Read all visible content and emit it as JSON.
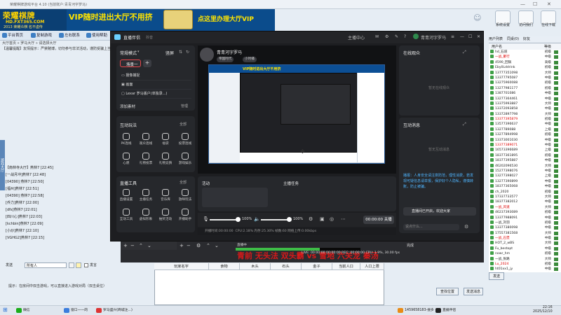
{
  "client": {
    "window_title": "荣耀棋牌游戏平台 4.10 (当前账户:青青河字罗马)",
    "logo_line1": "荣耀棋牌",
    "logo_domain": "HD.FXT365.COM",
    "logo_slogan": "2013 荣耀众棋 名不虚传",
    "banner_left": "VIP随时进出大厅不用挤",
    "banner_right": "点这里办理大厅VIP",
    "tools": [
      {
        "label": "系统设置"
      },
      {
        "label": "访问我们"
      },
      {
        "label": "在线下载"
      }
    ],
    "nav": [
      "平台首页",
      "复制游戏",
      "左右联系",
      "使用帮助"
    ],
    "breadcrumb": "大厅首页 » 罗马大厅 » 请选择大厅",
    "notice": "【温馨提醒】友情提示：严禁赌博，切勿参与非法活动，谨防受骗上当。",
    "left_strip": "游戏大厅",
    "chat": [
      "【南林寺大厅】燕林7 [22:45]",
      "[一战月冲]燕林7 [22:48]",
      "[04390] 燕林7 [22:50]",
      "[福州]燕林7 [22:51]",
      "[04390] 燕林7 [22:58]",
      "[乔力]燕林7 [22:00]",
      "[dfs]燕林7 [22:01]",
      "[四川心]燕林7 [22:03]",
      "[kchbin]燕林7 [22:09]",
      "[小炒]燕林7 [22:10]",
      "[VGHG2]燕林7 [22:15]"
    ],
    "chat_label": "发送",
    "chat_input": "所有人",
    "chat_check": "发言",
    "hint": "提示：在房间中双击游戏，可以直接进入游戏对局（双击桌位）",
    "buttons": {
      "find": "查找位置",
      "send": "发送消息",
      "ok": "发送"
    }
  },
  "right_list": {
    "tabs": [
      "用户列表",
      "同桌(0)",
      "好友"
    ],
    "header": {
      "name": "用户名",
      "level": "等级"
    },
    "users": [
      {
        "name": "hd_石道",
        "level": "初级",
        "red": false
      },
      {
        "name": "一战_聚行",
        "level": "中级",
        "red": true
      },
      {
        "name": "4590_回锅",
        "level": "高级",
        "red": false
      },
      {
        "name": "Eby0Lddrink",
        "level": "初级",
        "red": false
      },
      {
        "name": "13777351098",
        "level": "大师",
        "red": false
      },
      {
        "name": "13377795087",
        "level": "中级",
        "red": false
      },
      {
        "name": "13275960088",
        "level": "初级",
        "red": false
      },
      {
        "name": "13277981177",
        "level": "初级",
        "red": false
      },
      {
        "name": "1387701086",
        "level": "中级",
        "red": false
      },
      {
        "name": "13277364461",
        "level": "中级",
        "red": false
      },
      {
        "name": "13375993887",
        "level": "大师",
        "red": false
      },
      {
        "name": "13372093858",
        "level": "中级",
        "red": false
      },
      {
        "name": "13372897798",
        "level": "大师",
        "red": false
      },
      {
        "name": "13377395879",
        "level": "初级",
        "red": true
      },
      {
        "name": "13577396637",
        "level": "中级",
        "red": false
      },
      {
        "name": "1327789088",
        "level": "上级",
        "red": false
      },
      {
        "name": "13277894998",
        "level": "初级",
        "red": false
      },
      {
        "name": "13373001030",
        "level": "中级",
        "red": false
      },
      {
        "name": "13377389071",
        "level": "中级",
        "red": true
      },
      {
        "name": "16573396689",
        "level": "上级",
        "red": false
      },
      {
        "name": "18377361895",
        "level": "初级",
        "red": false
      },
      {
        "name": "18377395887",
        "level": "中级",
        "red": false
      },
      {
        "name": "46202096530",
        "level": "大师",
        "red": false
      },
      {
        "name": "15277398076",
        "level": "中级",
        "red": false
      },
      {
        "name": "13277398027",
        "level": "上级",
        "red": false
      },
      {
        "name": "13277390899",
        "level": "中级",
        "red": false
      },
      {
        "name": "18377365068",
        "level": "中级",
        "red": false
      },
      {
        "name": "ch_2020",
        "level": "初级",
        "red": false
      },
      {
        "name": "17337733577",
        "level": "大师",
        "red": false
      },
      {
        "name": "18377382012",
        "level": "中级",
        "red": false
      },
      {
        "name": "一战_风道",
        "level": "大师",
        "red": true
      },
      {
        "name": "46237393089",
        "level": "初级",
        "red": false
      },
      {
        "name": "13377988091",
        "level": "中级",
        "red": false
      },
      {
        "name": "一战_刘羽",
        "level": "初级",
        "red": false
      },
      {
        "name": "13377380098",
        "level": "中级",
        "red": false
      },
      {
        "name": "17557381568",
        "level": "大师",
        "red": false
      },
      {
        "name": "一战_石堡",
        "level": "中级",
        "red": true
      },
      {
        "name": "HOT_2_wBS",
        "level": "大师",
        "red": false
      },
      {
        "name": "Fu_bestopt",
        "level": "中级",
        "red": false
      },
      {
        "name": "nowr_hm",
        "level": "初级",
        "red": false
      },
      {
        "name": "一战_张路",
        "level": "大师",
        "red": false
      },
      {
        "name": "Lu_2024",
        "level": "初级",
        "red": true
      },
      {
        "name": "ht01xx1_jy",
        "level": "中级",
        "red": false
      },
      {
        "name": "htjfuas_wx0",
        "level": "初级",
        "red": false
      },
      {
        "name": "Fu_ldk",
        "level": "中级",
        "red": false
      }
    ]
  },
  "obs": {
    "title": "直播伴侣",
    "subtitle": "抖音",
    "top": [
      "主播中心",
      "消息",
      "设置",
      "反馈",
      "帮助"
    ],
    "account": "青青河字罗马",
    "mode_label": "常规模式",
    "layout_label": "竖屏",
    "scene": "场景一",
    "sources": [
      {
        "name": "摄像捕捉"
      },
      {
        "name": "画面"
      },
      {
        "name": "Lexar 罗马版户(单独录...)"
      }
    ],
    "add_source": "添加素材",
    "manage": "管理",
    "interact_title": "互动玩法",
    "all": "全部",
    "interact": [
      "PK连线",
      "观众连线",
      "福袋",
      "投票连线",
      "心愿",
      "礼物投票",
      "礼物竞猜",
      "游戏娱乐"
    ],
    "tools_title": "直播工具",
    "tools": [
      "直播设置",
      "主播任务",
      "音乐库",
      "放映玩法",
      "互动工具",
      "虚拟形象",
      "抽奖活动",
      "开播助手"
    ],
    "stream_name": "青青河字罗马",
    "tag1": "帝国时代",
    "tag2": "小时播",
    "capture_banner": "VIP随时进出大厅不用挤",
    "activity": "活动",
    "host_tasks": "主播任务",
    "mic_volume": "100%",
    "spk_volume": "100%",
    "live_time": "00:00:00",
    "live_label": "关播",
    "status": "CPU:2.18%  内存:25.30%  帧数:60  网络上传:0.00kbps",
    "status_prefix": "开播时间:00:00:00",
    "right1_title": "在线观众",
    "right1_empty": "暂无在线观众",
    "right2_title": "互动消息",
    "right2_empty": "暂无互动消息",
    "right2_msg": "播报：人身安全请注意防范，理性消费，若发现可疑信息请举报，保护好个人隐私，谨慎转账，防止被骗。",
    "right2_user": "直播间已开启，欢迎大家",
    "right2_input": "说点什么..."
  },
  "obs_bottom": {
    "tag": "直播中",
    "red_text": "青前 无头法 双头霸 vs 雪地 六关龙 秦汤",
    "live_line": "LIVE: 00:00:00  00:00:00  REC: 00:00:00  CPU: 1.9%, 30.00 fps",
    "right": "完成"
  },
  "table": {
    "headers": [
      "玩家名字",
      "食物",
      "木头",
      "石头",
      "金子",
      "当前人口",
      "人口上限"
    ]
  },
  "taskbar": {
    "items": [
      {
        "label": "微信",
        "color": "#1aad19"
      },
      {
        "label": "窗口一一的",
        "color": "#3b7ddd"
      },
      {
        "label": "罗马盛兴(商城注...)",
        "color": "#d33"
      },
      {
        "label": "1459658183-搜多",
        "color": "#e88b16"
      },
      {
        "label": "直播伴侣",
        "color": "#222"
      }
    ],
    "time": "22:16",
    "date": "2025/12/10"
  }
}
